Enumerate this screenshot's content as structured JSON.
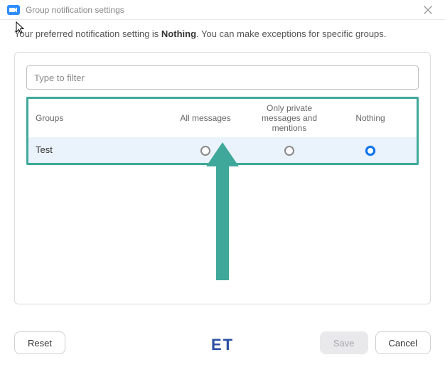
{
  "window": {
    "title": "Group notification settings"
  },
  "description": {
    "prefix": "Your preferred notification setting is ",
    "setting": "Nothing",
    "suffix": ". You can make exceptions for specific groups."
  },
  "filter": {
    "placeholder": "Type to filter"
  },
  "table": {
    "headers": {
      "groups": "Groups",
      "all": "All messages",
      "mentions": "Only private messages and mentions",
      "nothing": "Nothing"
    },
    "rows": [
      {
        "name": "Test",
        "selected": "nothing"
      }
    ]
  },
  "footer": {
    "reset": "Reset",
    "save": "Save",
    "cancel": "Cancel"
  },
  "watermark": "ET"
}
